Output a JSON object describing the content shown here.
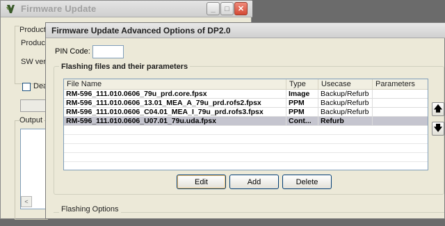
{
  "background_window": {
    "title": "Firmware Update",
    "labels": [
      "Product",
      "Product",
      "SW vers",
      "Dea",
      "Output"
    ],
    "scroll_left_glyph": "<"
  },
  "dialog": {
    "title": "Firmware Update Advanced Options of DP2.0",
    "pin_label": "PIN Code:",
    "pin_value": "",
    "group_title": "Flashing files and their parameters",
    "columns": [
      "File Name",
      "Type",
      "Usecase",
      "Parameters"
    ],
    "rows": [
      {
        "file": "RM-596_111.010.0606_79u_prd.core.fpsx",
        "type": "Image",
        "usecase": "Backup/Refurb",
        "params": "",
        "selected": false
      },
      {
        "file": "RM-596_111.010.0606_13.01_MEA_A_79u_prd.rofs2.fpsx",
        "type": "PPM",
        "usecase": "Backup/Refurb",
        "params": "",
        "selected": false
      },
      {
        "file": "RM-596_111.010.0606_C04.01_MEA_I_79u_prd.rofs3.fpsx",
        "type": "PPM",
        "usecase": "Backup/Refurb",
        "params": "",
        "selected": false
      },
      {
        "file": "RM-596_111.010.0606_U07.01_79u.uda.fpsx",
        "type": "Cont...",
        "usecase": "Refurb",
        "params": "",
        "selected": true
      }
    ],
    "buttons": {
      "edit": "Edit",
      "add": "Add",
      "delete": "Delete"
    },
    "move_up_glyph": "🡅",
    "move_down_glyph": "🡇",
    "flashing_options_title": "Flashing Options"
  },
  "icons": {
    "app": "firmware-app-icon",
    "minimize": "minimize-icon",
    "maximize": "maximize-icon",
    "close": "close-icon",
    "up": "arrow-up-icon",
    "down": "arrow-down-icon"
  },
  "colors": {
    "selection": "#c5c5cf",
    "close_button": "#d44a35",
    "window_bg": "#ece9d8"
  }
}
